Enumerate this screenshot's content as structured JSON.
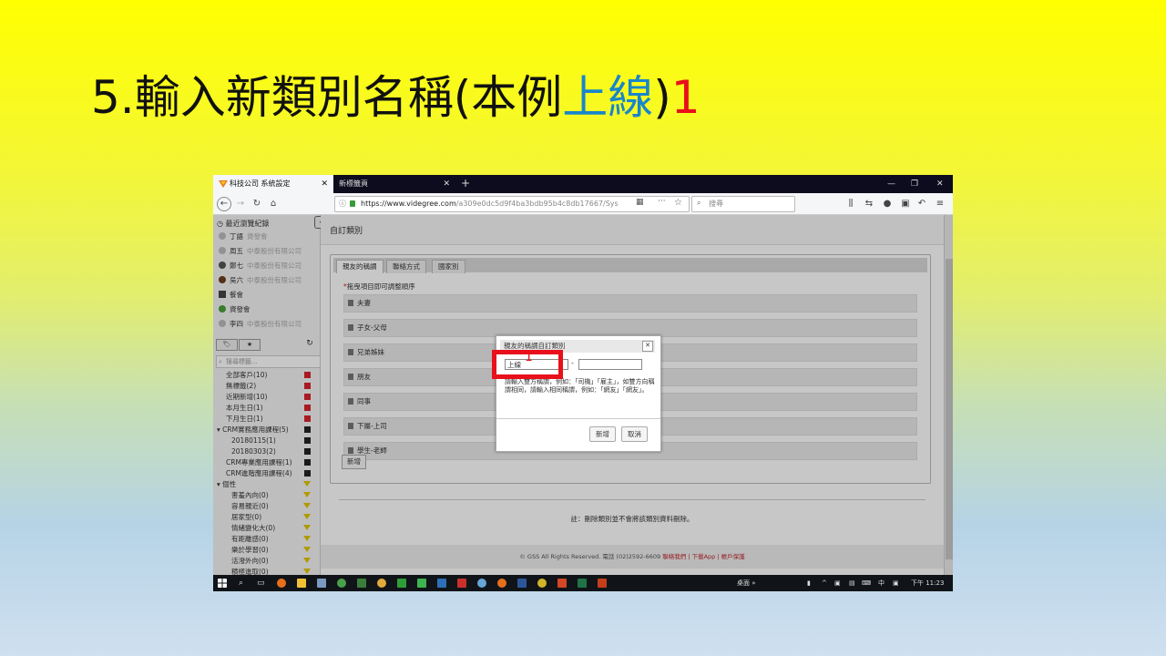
{
  "slide": {
    "title_main": "5.輸入新類別名稱(本例",
    "title_highlight": "上線",
    "title_close": ")",
    "title_step": "1"
  },
  "browser": {
    "tabs": [
      {
        "label": "科技公司 系統設定",
        "close": "✕"
      },
      {
        "label": "新標籤頁",
        "close": "✕"
      }
    ],
    "new_tab": "+",
    "window_controls": [
      "—",
      "❐",
      "✕"
    ],
    "url_host": "https://www.videgree.com",
    "url_path": "/a309e0dc5d9f4ba3bdb95b4c8db17667/Sys",
    "search_placeholder": "搜尋"
  },
  "sidebar": {
    "recent_title": "最近瀏覽紀錄",
    "recent": [
      {
        "name": "丁語",
        "sub": "資發會"
      },
      {
        "name": "周五",
        "sub": "中泰股份有限公司"
      },
      {
        "name": "鄭七",
        "sub": "中泰股份有限公司"
      },
      {
        "name": "吳六",
        "sub": "中泰股份有限公司"
      },
      {
        "name": "餐會",
        "sub": ""
      },
      {
        "name": "資發會",
        "sub": ""
      },
      {
        "name": "李四",
        "sub": "中泰股份有限公司"
      }
    ],
    "tag_tab": "🏷",
    "star_tab": "★",
    "search_placeholder": "搜尋標籤...",
    "categories": [
      {
        "label": "全部客戶(10)",
        "indent": 14,
        "mark": "red"
      },
      {
        "label": "無標籤(2)",
        "indent": 14,
        "mark": "red"
      },
      {
        "label": "近期新增(10)",
        "indent": 14,
        "mark": "red"
      },
      {
        "label": "本月生日(1)",
        "indent": 14,
        "mark": "red"
      },
      {
        "label": "下月生日(1)",
        "indent": 14,
        "mark": "red"
      },
      {
        "label": "▾ CRM實務應用課程(5)",
        "indent": 4,
        "mark": "blk"
      },
      {
        "label": "20180115(1)",
        "indent": 20,
        "mark": "blk"
      },
      {
        "label": "20180303(2)",
        "indent": 20,
        "mark": "blk"
      },
      {
        "label": "CRM專業應用課程(1)",
        "indent": 14,
        "mark": "blk"
      },
      {
        "label": "CRM進階應用課程(4)",
        "indent": 14,
        "mark": "blk"
      },
      {
        "label": "▾ 個性",
        "indent": 4,
        "mark": "yel"
      },
      {
        "label": "害羞內向(0)",
        "indent": 20,
        "mark": "yel"
      },
      {
        "label": "容易親近(0)",
        "indent": 20,
        "mark": "yel"
      },
      {
        "label": "居家型(0)",
        "indent": 20,
        "mark": "yel"
      },
      {
        "label": "情緒變化大(0)",
        "indent": 20,
        "mark": "yel"
      },
      {
        "label": "有距離感(0)",
        "indent": 20,
        "mark": "yel"
      },
      {
        "label": "樂於學習(0)",
        "indent": 20,
        "mark": "yel"
      },
      {
        "label": "活潑外向(0)",
        "indent": 20,
        "mark": "yel"
      },
      {
        "label": "積極進取(0)",
        "indent": 20,
        "mark": "yel"
      }
    ]
  },
  "main": {
    "header": "自訂類別",
    "tabs": [
      "親友的稱謂",
      "聯絡方式",
      "國家別"
    ],
    "sort_hint": "拖曳項目即可調整順序",
    "rows": [
      "夫妻",
      "子女-父母",
      "兄弟姊妹",
      "朋友",
      "同事",
      "下屬-上司",
      "學生-老師"
    ],
    "add_label": "新增",
    "note": "註：刪除類別並不會將該類別資料刪除。",
    "footer_text": "© GSS All Rights Reserved. 電話 (02)2592-6609",
    "footer_links": "聯絡我們 | 下載App | 帳戶保護"
  },
  "dialog": {
    "title": "親友的稱謂自訂類別",
    "close": "✕",
    "field1_value": "上線",
    "dash": "-",
    "field2_value": "",
    "hint": "請輸入雙方稱謂，例如：「司機」「雇主」，如雙方向稱謂相同，請輸入相同稱謂，例如：「網友」「網友」。",
    "add": "新增",
    "cancel": "取消",
    "marker": "1"
  },
  "taskbar": {
    "desktop": "桌面",
    "ime": "中",
    "time": "下午 11:23"
  }
}
